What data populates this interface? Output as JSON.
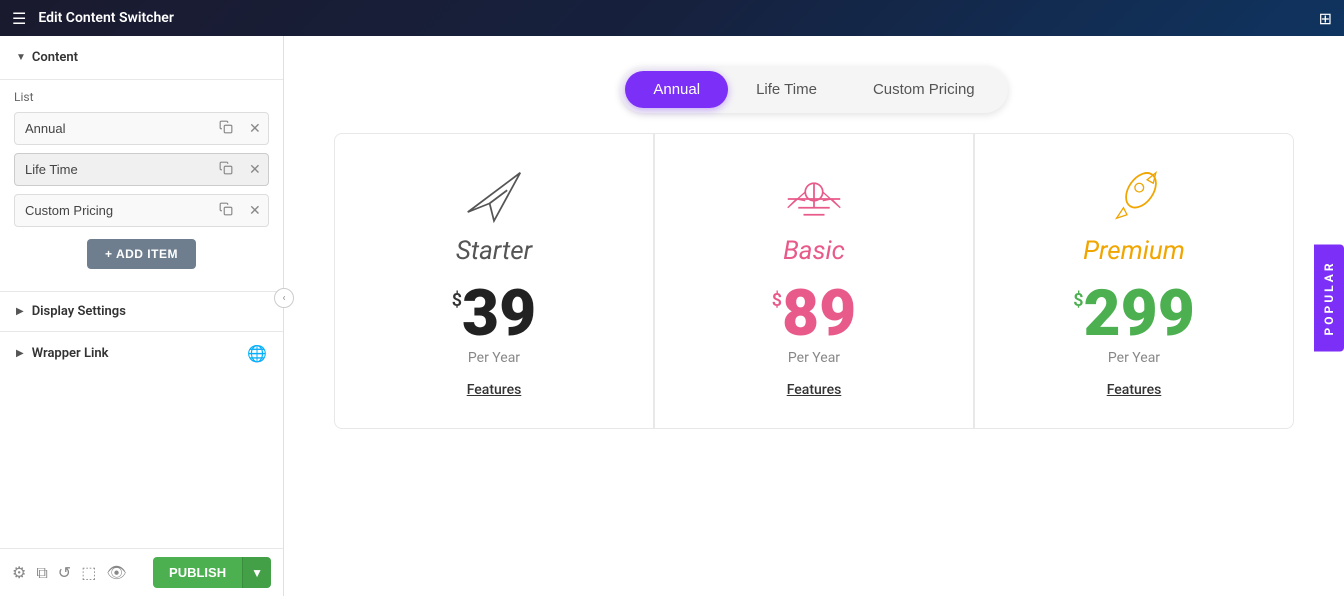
{
  "topBar": {
    "title": "Edit Content Switcher"
  },
  "sidebar": {
    "contentLabel": "Content",
    "listLabel": "List",
    "items": [
      {
        "value": "Annual",
        "id": "annual"
      },
      {
        "value": "Life Time",
        "id": "lifetime"
      },
      {
        "value": "Custom Pricing",
        "id": "custom"
      }
    ],
    "addItemLabel": "+ ADD ITEM",
    "displaySettings": "Display Settings",
    "wrapperLink": "Wrapper Link",
    "publishLabel": "PUBLISH"
  },
  "switcher": {
    "tabs": [
      {
        "id": "annual",
        "label": "Annual",
        "active": true
      },
      {
        "id": "lifetime",
        "label": "Life Time",
        "active": false
      },
      {
        "id": "custom",
        "label": "Custom Pricing",
        "active": false
      }
    ]
  },
  "cards": [
    {
      "id": "starter",
      "title": "Starter",
      "icon": "paper-plane",
      "currency": "$",
      "price": "39",
      "period": "Per Year",
      "featuresLabel": "Features"
    },
    {
      "id": "basic",
      "title": "Basic",
      "icon": "plane",
      "currency": "$",
      "price": "89",
      "period": "Per Year",
      "featuresLabel": "Features"
    },
    {
      "id": "premium",
      "title": "Premium",
      "icon": "rocket",
      "currency": "$",
      "price": "299",
      "period": "Per Year",
      "featuresLabel": "Features",
      "popular": true
    }
  ],
  "popularBadge": "POPULAR",
  "colors": {
    "accent": "#7b2ff7",
    "starter": "#555555",
    "basic": "#e85a8a",
    "premium": "#f0a500",
    "premiumPrice": "#4caf50",
    "publishGreen": "#4caf50"
  }
}
